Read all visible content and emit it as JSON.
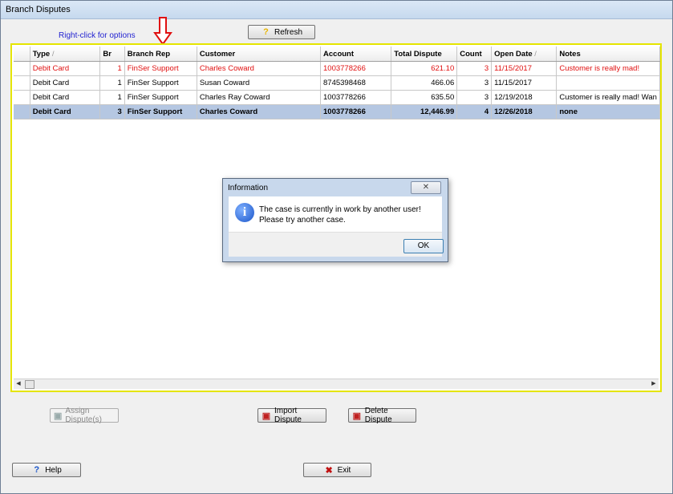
{
  "window": {
    "title": "Branch Disputes"
  },
  "hint": "Right-click for options",
  "toolbar": {
    "refresh_label": "Refresh"
  },
  "table": {
    "headers": [
      "",
      "Type",
      "Br",
      "Branch Rep",
      "Customer",
      "Account",
      "Total Dispute",
      "Count",
      "Open Date",
      "Notes"
    ],
    "rows": [
      {
        "type": "Debit Card",
        "br": "1",
        "rep": "FinSer Support",
        "customer": "Charles Coward",
        "account": "1003778266",
        "total": "621.10",
        "count": "3",
        "date": "11/15/2017",
        "notes": "Customer is really mad!"
      },
      {
        "type": "Debit Card",
        "br": "1",
        "rep": "FinSer Support",
        "customer": "Susan Coward",
        "account": "8745398468",
        "total": "466.06",
        "count": "3",
        "date": "11/15/2017",
        "notes": ""
      },
      {
        "type": "Debit Card",
        "br": "1",
        "rep": "FinSer Support",
        "customer": "Charles Ray Coward",
        "account": "1003778266",
        "total": "635.50",
        "count": "3",
        "date": "12/19/2018",
        "notes": "Customer is really mad! Wan"
      },
      {
        "type": "Debit Card",
        "br": "3",
        "rep": "FinSer Support",
        "customer": "Charles Coward",
        "account": "1003778266",
        "total": "12,446.99",
        "count": "4",
        "date": "12/26/2018",
        "notes": "none"
      }
    ]
  },
  "buttons": {
    "assign": "Assign Dispute(s)",
    "import": "Import Dispute",
    "delete": "Delete Dispute",
    "help": "Help",
    "exit": "Exit"
  },
  "dialog": {
    "title": "Information",
    "message": "The case is currently in work by another user! Please try another case.",
    "ok": "OK"
  },
  "colors": {
    "error_text": "#e01010",
    "selected_row": "#b5c7e2",
    "hint_text": "#1f1fd0",
    "frame_highlight": "#e5e500"
  }
}
